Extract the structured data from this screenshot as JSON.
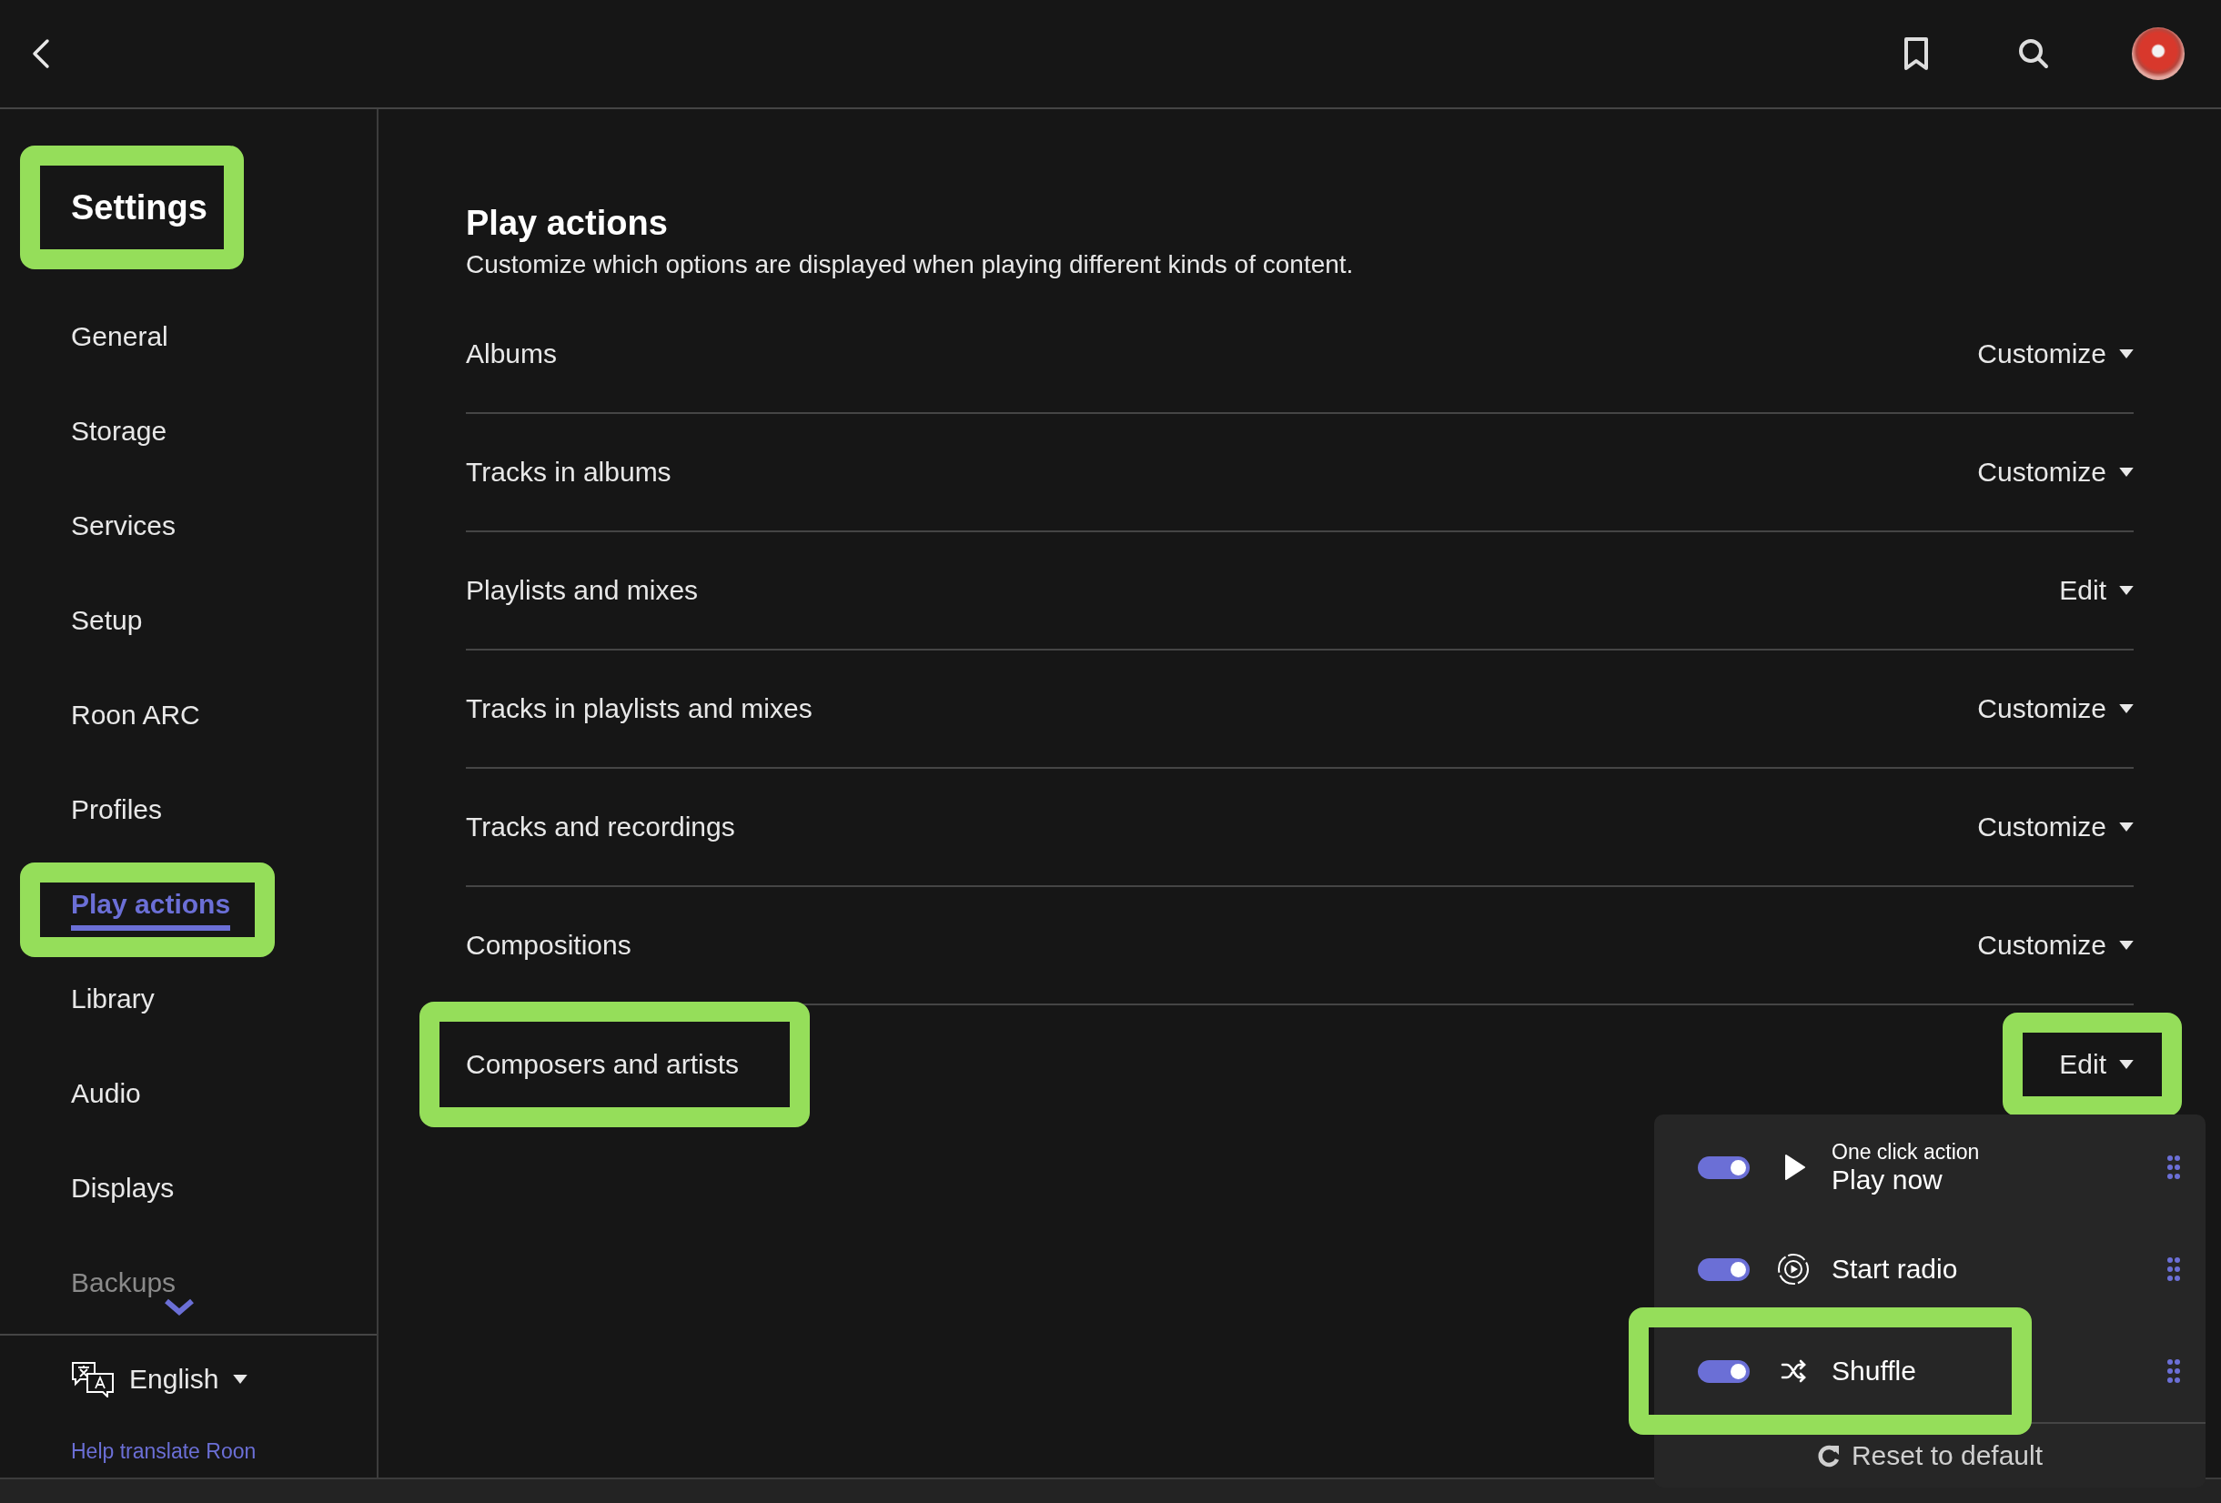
{
  "sidebar": {
    "title": "Settings",
    "title_highlighted": true,
    "items": [
      {
        "label": "General",
        "selected": false,
        "highlighted": false,
        "dimmed": false
      },
      {
        "label": "Storage",
        "selected": false,
        "highlighted": false,
        "dimmed": false
      },
      {
        "label": "Services",
        "selected": false,
        "highlighted": false,
        "dimmed": false
      },
      {
        "label": "Setup",
        "selected": false,
        "highlighted": false,
        "dimmed": false
      },
      {
        "label": "Roon ARC",
        "selected": false,
        "highlighted": false,
        "dimmed": false
      },
      {
        "label": "Profiles",
        "selected": false,
        "highlighted": false,
        "dimmed": false
      },
      {
        "label": "Play actions",
        "selected": true,
        "highlighted": true,
        "dimmed": false
      },
      {
        "label": "Library",
        "selected": false,
        "highlighted": false,
        "dimmed": false
      },
      {
        "label": "Audio",
        "selected": false,
        "highlighted": false,
        "dimmed": false
      },
      {
        "label": "Displays",
        "selected": false,
        "highlighted": false,
        "dimmed": false
      },
      {
        "label": "Backups",
        "selected": false,
        "highlighted": false,
        "dimmed": true
      }
    ],
    "language": "English",
    "help_link": "Help translate Roon"
  },
  "content": {
    "title": "Play actions",
    "subtitle": "Customize which options are displayed when playing different kinds of content.",
    "rows": [
      {
        "label": "Albums",
        "action": "Customize",
        "label_highlighted": false,
        "action_highlighted": false
      },
      {
        "label": "Tracks in albums",
        "action": "Customize",
        "label_highlighted": false,
        "action_highlighted": false
      },
      {
        "label": "Playlists and mixes",
        "action": "Edit",
        "label_highlighted": false,
        "action_highlighted": false
      },
      {
        "label": "Tracks in playlists and mixes",
        "action": "Customize",
        "label_highlighted": false,
        "action_highlighted": false
      },
      {
        "label": "Tracks and recordings",
        "action": "Customize",
        "label_highlighted": false,
        "action_highlighted": false
      },
      {
        "label": "Compositions",
        "action": "Customize",
        "label_highlighted": false,
        "action_highlighted": false
      },
      {
        "label": "Composers and artists",
        "action": "Edit",
        "label_highlighted": true,
        "action_highlighted": true
      }
    ]
  },
  "popup": {
    "items": [
      {
        "kind": "play",
        "caption": "One click action",
        "label": "Play now",
        "on": true,
        "highlighted": false
      },
      {
        "kind": "radio",
        "label": "Start radio",
        "on": true,
        "highlighted": false
      },
      {
        "kind": "shuffle",
        "label": "Shuffle",
        "on": true,
        "highlighted": true
      }
    ],
    "reset": "Reset to default"
  }
}
